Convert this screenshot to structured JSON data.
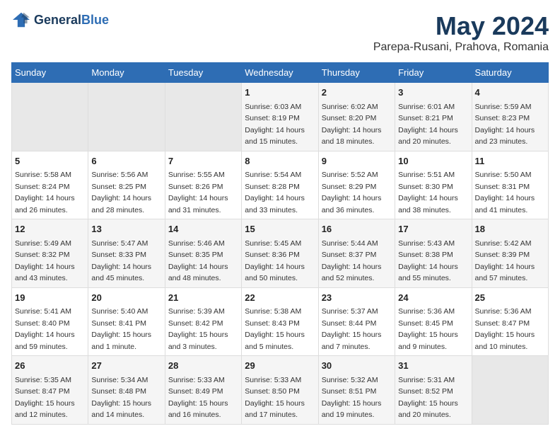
{
  "header": {
    "logo_general": "General",
    "logo_blue": "Blue",
    "title": "May 2024",
    "subtitle": "Parepa-Rusani, Prahova, Romania"
  },
  "weekdays": [
    "Sunday",
    "Monday",
    "Tuesday",
    "Wednesday",
    "Thursday",
    "Friday",
    "Saturday"
  ],
  "weeks": [
    [
      {
        "day": "",
        "empty": true
      },
      {
        "day": "",
        "empty": true
      },
      {
        "day": "",
        "empty": true
      },
      {
        "day": "1",
        "sunrise": "6:03 AM",
        "sunset": "8:19 PM",
        "daylight": "14 hours and 15 minutes."
      },
      {
        "day": "2",
        "sunrise": "6:02 AM",
        "sunset": "8:20 PM",
        "daylight": "14 hours and 18 minutes."
      },
      {
        "day": "3",
        "sunrise": "6:01 AM",
        "sunset": "8:21 PM",
        "daylight": "14 hours and 20 minutes."
      },
      {
        "day": "4",
        "sunrise": "5:59 AM",
        "sunset": "8:23 PM",
        "daylight": "14 hours and 23 minutes."
      }
    ],
    [
      {
        "day": "5",
        "sunrise": "5:58 AM",
        "sunset": "8:24 PM",
        "daylight": "14 hours and 26 minutes."
      },
      {
        "day": "6",
        "sunrise": "5:56 AM",
        "sunset": "8:25 PM",
        "daylight": "14 hours and 28 minutes."
      },
      {
        "day": "7",
        "sunrise": "5:55 AM",
        "sunset": "8:26 PM",
        "daylight": "14 hours and 31 minutes."
      },
      {
        "day": "8",
        "sunrise": "5:54 AM",
        "sunset": "8:28 PM",
        "daylight": "14 hours and 33 minutes."
      },
      {
        "day": "9",
        "sunrise": "5:52 AM",
        "sunset": "8:29 PM",
        "daylight": "14 hours and 36 minutes."
      },
      {
        "day": "10",
        "sunrise": "5:51 AM",
        "sunset": "8:30 PM",
        "daylight": "14 hours and 38 minutes."
      },
      {
        "day": "11",
        "sunrise": "5:50 AM",
        "sunset": "8:31 PM",
        "daylight": "14 hours and 41 minutes."
      }
    ],
    [
      {
        "day": "12",
        "sunrise": "5:49 AM",
        "sunset": "8:32 PM",
        "daylight": "14 hours and 43 minutes."
      },
      {
        "day": "13",
        "sunrise": "5:47 AM",
        "sunset": "8:33 PM",
        "daylight": "14 hours and 45 minutes."
      },
      {
        "day": "14",
        "sunrise": "5:46 AM",
        "sunset": "8:35 PM",
        "daylight": "14 hours and 48 minutes."
      },
      {
        "day": "15",
        "sunrise": "5:45 AM",
        "sunset": "8:36 PM",
        "daylight": "14 hours and 50 minutes."
      },
      {
        "day": "16",
        "sunrise": "5:44 AM",
        "sunset": "8:37 PM",
        "daylight": "14 hours and 52 minutes."
      },
      {
        "day": "17",
        "sunrise": "5:43 AM",
        "sunset": "8:38 PM",
        "daylight": "14 hours and 55 minutes."
      },
      {
        "day": "18",
        "sunrise": "5:42 AM",
        "sunset": "8:39 PM",
        "daylight": "14 hours and 57 minutes."
      }
    ],
    [
      {
        "day": "19",
        "sunrise": "5:41 AM",
        "sunset": "8:40 PM",
        "daylight": "14 hours and 59 minutes."
      },
      {
        "day": "20",
        "sunrise": "5:40 AM",
        "sunset": "8:41 PM",
        "daylight": "15 hours and 1 minute."
      },
      {
        "day": "21",
        "sunrise": "5:39 AM",
        "sunset": "8:42 PM",
        "daylight": "15 hours and 3 minutes."
      },
      {
        "day": "22",
        "sunrise": "5:38 AM",
        "sunset": "8:43 PM",
        "daylight": "15 hours and 5 minutes."
      },
      {
        "day": "23",
        "sunrise": "5:37 AM",
        "sunset": "8:44 PM",
        "daylight": "15 hours and 7 minutes."
      },
      {
        "day": "24",
        "sunrise": "5:36 AM",
        "sunset": "8:45 PM",
        "daylight": "15 hours and 9 minutes."
      },
      {
        "day": "25",
        "sunrise": "5:36 AM",
        "sunset": "8:47 PM",
        "daylight": "15 hours and 10 minutes."
      }
    ],
    [
      {
        "day": "26",
        "sunrise": "5:35 AM",
        "sunset": "8:47 PM",
        "daylight": "15 hours and 12 minutes."
      },
      {
        "day": "27",
        "sunrise": "5:34 AM",
        "sunset": "8:48 PM",
        "daylight": "15 hours and 14 minutes."
      },
      {
        "day": "28",
        "sunrise": "5:33 AM",
        "sunset": "8:49 PM",
        "daylight": "15 hours and 16 minutes."
      },
      {
        "day": "29",
        "sunrise": "5:33 AM",
        "sunset": "8:50 PM",
        "daylight": "15 hours and 17 minutes."
      },
      {
        "day": "30",
        "sunrise": "5:32 AM",
        "sunset": "8:51 PM",
        "daylight": "15 hours and 19 minutes."
      },
      {
        "day": "31",
        "sunrise": "5:31 AM",
        "sunset": "8:52 PM",
        "daylight": "15 hours and 20 minutes."
      },
      {
        "day": "",
        "empty": true
      }
    ]
  ],
  "labels": {
    "sunrise": "Sunrise:",
    "sunset": "Sunset:",
    "daylight": "Daylight:"
  }
}
